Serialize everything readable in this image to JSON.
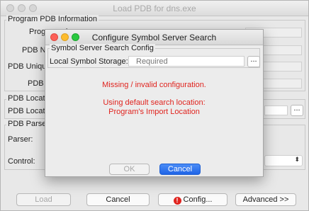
{
  "window": {
    "title": "Load PDB for dns.exe"
  },
  "program_pdb": {
    "group_title": "Program PDB Information",
    "program_label": "Program: dns.exe",
    "pdb_name_label": "PDB Na",
    "pdb_unique_label": "PDB Unique",
    "pdb_age_label": "PDB A"
  },
  "pdb_location": {
    "group_title": "PDB Location",
    "field_label": "PDB Location",
    "browse_label": "..."
  },
  "pdb_parser": {
    "group_title": "PDB Parser",
    "parser_label": "Parser:",
    "control_label": "Control:"
  },
  "bottom_buttons": {
    "load": "Load",
    "cancel": "Cancel",
    "config": "Config...",
    "advanced": "Advanced >>",
    "config_icon": "!"
  },
  "modal": {
    "title": "Configure Symbol Server Search",
    "group_title": "Symbol Server Search Config",
    "storage_label": "Local Symbol Storage:",
    "storage_placeholder": "Required",
    "browse_label": "...",
    "message_line1": "Missing / invalid configuration.",
    "message_line2": "Using default search location:",
    "message_line3": "Program's Import Location",
    "ok_label": "OK",
    "cancel_label": "Cancel"
  },
  "colors": {
    "error_text": "#e0241f",
    "default_button": "#2a6ff0"
  }
}
